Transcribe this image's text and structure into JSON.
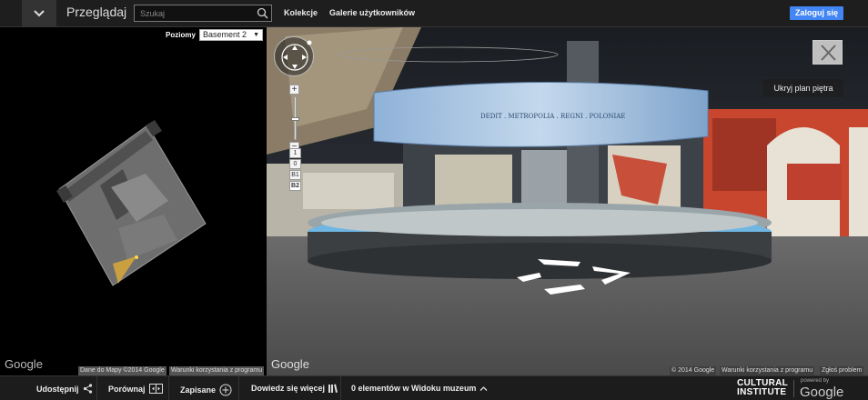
{
  "header": {
    "brand": "Przeglądaj",
    "search": {
      "placeholder": "Szukaj",
      "value": ""
    },
    "nav": [
      "Kolekcje",
      "Galerie użytkowników"
    ],
    "login_label": "Zaloguj się",
    "login_color": "#4285f4"
  },
  "floor_plan": {
    "levels_label": "Poziomy",
    "selected_level": "Basement 2",
    "google_logo": "Google",
    "attribution": "Dane do Mapy ©2014 Google",
    "terms": "Warunki korzystania z programu"
  },
  "street_view": {
    "zoom_in": "+",
    "zoom_out": "−",
    "floors": [
      "1",
      "0",
      "B1",
      "B2"
    ],
    "active_floor": "B2",
    "hide_plan_label": "Ukryj plan piętra",
    "google_logo": "Google",
    "copyright": "© 2014 Google",
    "terms": "Warunki korzystania z programu",
    "report": "Zgłoś problem",
    "exhibit_banner_text": "DEDIT . METROPOLIA . REGNI . POLONIAE"
  },
  "footer": {
    "share": "Udostępnij",
    "compare": "Porównaj",
    "saved": "Zapisane",
    "learn_more": "Dowiedz się więcej",
    "museum_view": "0 elementów w Widoku muzeum",
    "logo_line1": "CULTURAL",
    "logo_line2": "INSTITUTE",
    "powered_by": "powered by",
    "powered_google": "Google"
  }
}
